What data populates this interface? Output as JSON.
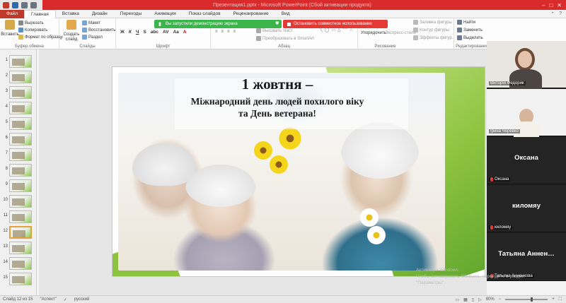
{
  "window": {
    "title": "Презентация1.pptx - Microsoft PowerPoint (Сбой активации продукта)"
  },
  "tabs": [
    "Файл",
    "Главная",
    "Вставка",
    "Дизайн",
    "Переходы",
    "Анимация",
    "Показ слайдов",
    "Рецензирование",
    "Вид"
  ],
  "ribbon": {
    "clipboard": {
      "paste": "Вставить",
      "cut": "Вырезать",
      "copy": "Копировать",
      "format": "Формат по образцу",
      "label": "Буфер обмена"
    },
    "slides": {
      "create": "Создать слайд",
      "layout": "Макет",
      "reset": "Восстановить",
      "section": "Раздел",
      "label": "Слайды"
    },
    "font": {
      "label": "Шрифт"
    },
    "paragraph": {
      "label": "Абзац",
      "text_dir": "Высовать текст",
      "smartart": "Преобразовать в SmartArt"
    },
    "drawing": {
      "arrange": "Упорядочить",
      "quick_styles": "Экспресс-стили",
      "fill": "Заливка фигуры",
      "outline": "Контур фигуры",
      "effects": "Эффекты фигур",
      "label": "Рисование"
    },
    "editing": {
      "find": "Найти",
      "replace": "Заменить",
      "select": "Выделить",
      "label": "Редактирование"
    }
  },
  "share": {
    "green_text": "Вы запустили демонстрацию экрана",
    "red_text": "Остановить совместное использование"
  },
  "thumbnails": {
    "numbers": [
      "1",
      "2",
      "3",
      "4",
      "5",
      "6",
      "7",
      "8",
      "9",
      "10",
      "11",
      "12",
      "13",
      "14",
      "15"
    ],
    "selected": "12"
  },
  "slide": {
    "title": "1 жовтня –",
    "subtitle_line1": "Міжнародний день людей похилого віку",
    "subtitle_line2": "та День ветерана!"
  },
  "participants": [
    {
      "name": "Вікторія Федорик",
      "big_name": "",
      "video": true,
      "muted": false
    },
    {
      "name": "Ірина Черевко",
      "big_name": "",
      "video": true,
      "muted": false
    },
    {
      "name": "Оксана",
      "big_name": "Оксана",
      "video": false,
      "muted": true
    },
    {
      "name": "киломяу",
      "big_name": "киломяу",
      "video": false,
      "muted": true
    },
    {
      "name": "Татьяна Анненкова",
      "big_name": "Татьяна Аннен…",
      "video": false,
      "muted": true
    }
  ],
  "status": {
    "slide": "Слайд 12 из 15",
    "theme": "\"Аспект\"",
    "lang": "русский",
    "zoom": "80%"
  },
  "watermark": {
    "line1": "Активация Windows",
    "line2": "Чтобы активировать Windows, перейдите в раздел",
    "line3": "\"Параметры\"."
  }
}
